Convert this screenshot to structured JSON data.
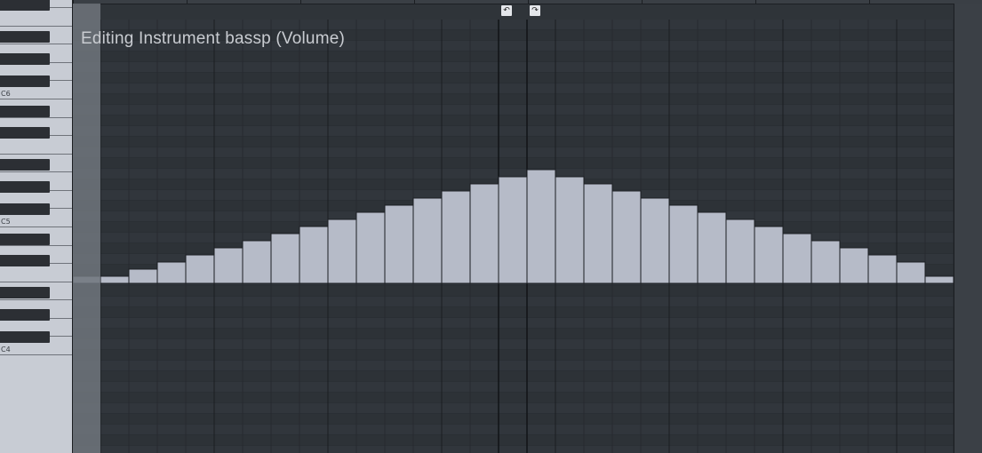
{
  "editor": {
    "title": "Editing Instrument bassp (Volume)"
  },
  "keyboard": {
    "octave_labels": [
      "C6",
      "C5",
      "C4"
    ]
  },
  "ruler": {
    "loop_start_icon": "loop-start-icon",
    "loop_end_icon": "loop-end-icon"
  },
  "envelope": {
    "step_count": 30,
    "baseline_level": 0,
    "levels": [
      1,
      2,
      3,
      4,
      5,
      6,
      7,
      8,
      9,
      10,
      11,
      12,
      13,
      14,
      15,
      16,
      15,
      14,
      13,
      12,
      11,
      10,
      9,
      8,
      7,
      6,
      5,
      4,
      3,
      1
    ],
    "max_level": 16,
    "bar_color": "#b6bbc8",
    "grid_color": "#373c42"
  },
  "colors": {
    "background": "#2a2f34",
    "keyboard_white": "#c8ccd4",
    "keyboard_black": "#2c2f34"
  }
}
